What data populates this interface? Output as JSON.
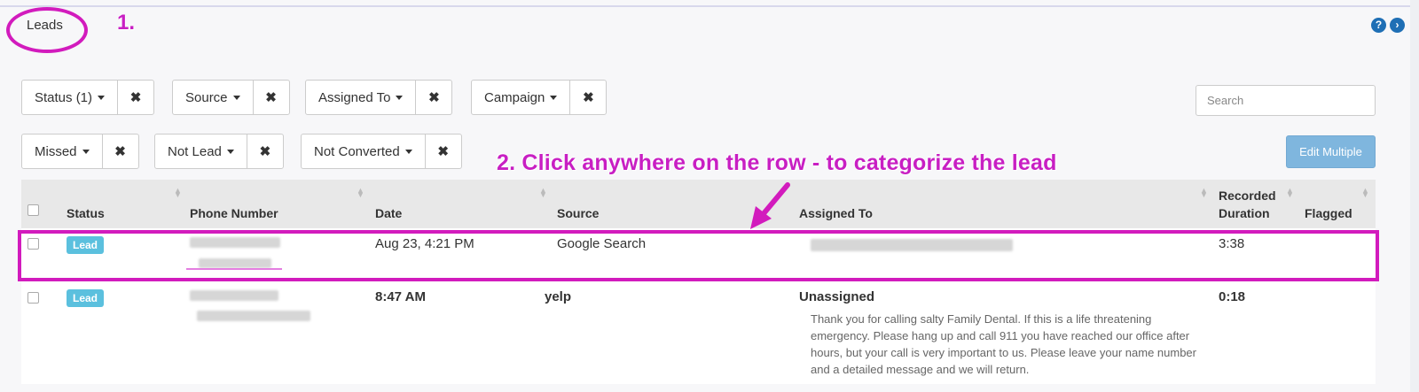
{
  "page": {
    "title": "Leads"
  },
  "annotations": {
    "step1": "1.",
    "step2": "2. Click anywhere on the row - to categorize the lead"
  },
  "header_icons": {
    "help": "?",
    "next": "›"
  },
  "filters_row1": [
    {
      "label": "Status (1)",
      "clear": "✖"
    },
    {
      "label": "Source",
      "clear": "✖"
    },
    {
      "label": "Assigned To",
      "clear": "✖"
    },
    {
      "label": "Campaign",
      "clear": "✖"
    }
  ],
  "filters_row2": [
    {
      "label": "Missed",
      "clear": "✖"
    },
    {
      "label": "Not Lead",
      "clear": "✖"
    },
    {
      "label": "Not Converted",
      "clear": "✖"
    }
  ],
  "search": {
    "placeholder": "Search"
  },
  "edit_multiple": {
    "label": "Edit Multiple"
  },
  "table": {
    "columns": {
      "status": "Status",
      "phone": "Phone Number",
      "date": "Date",
      "source": "Source",
      "assigned": "Assigned To",
      "recorded_line1": "Recorded",
      "recorded_line2": "Duration",
      "flagged": "Flagged"
    },
    "rows": [
      {
        "status": "Lead",
        "date": "Aug 23, 4:21 PM",
        "source": "Google Search",
        "assigned": "",
        "duration": "3:38"
      },
      {
        "status": "Lead",
        "date": "8:47 AM",
        "source": "yelp",
        "assigned": "Unassigned",
        "duration": "0:18",
        "transcript": "Thank you for calling salty Family Dental. If this is a life threatening emergency. Please hang up and call 911 you have reached our office after hours, but your call is very important to us. Please leave your name number and a detailed message and we will return."
      }
    ]
  },
  "colors": {
    "annotation": "#d21bbd",
    "badge": "#5bc0de",
    "edit_button": "#7fb6de",
    "header_bg": "#e8e8e8"
  }
}
